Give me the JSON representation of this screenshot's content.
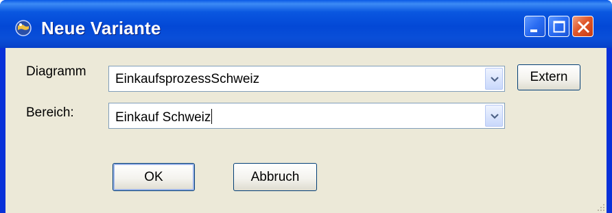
{
  "window": {
    "title": "Neue Variante"
  },
  "form": {
    "diagram_label": "Diagramm",
    "diagram_value": "EinkaufsprozessSchweiz",
    "area_label": "Bereich:",
    "area_value": "Einkauf Schweiz"
  },
  "buttons": {
    "extern": "Extern",
    "ok": "OK",
    "cancel": "Abbruch"
  },
  "colors": {
    "titlebar": "#0a57e0",
    "client": "#ece9d8",
    "close_button": "#e0582c"
  }
}
